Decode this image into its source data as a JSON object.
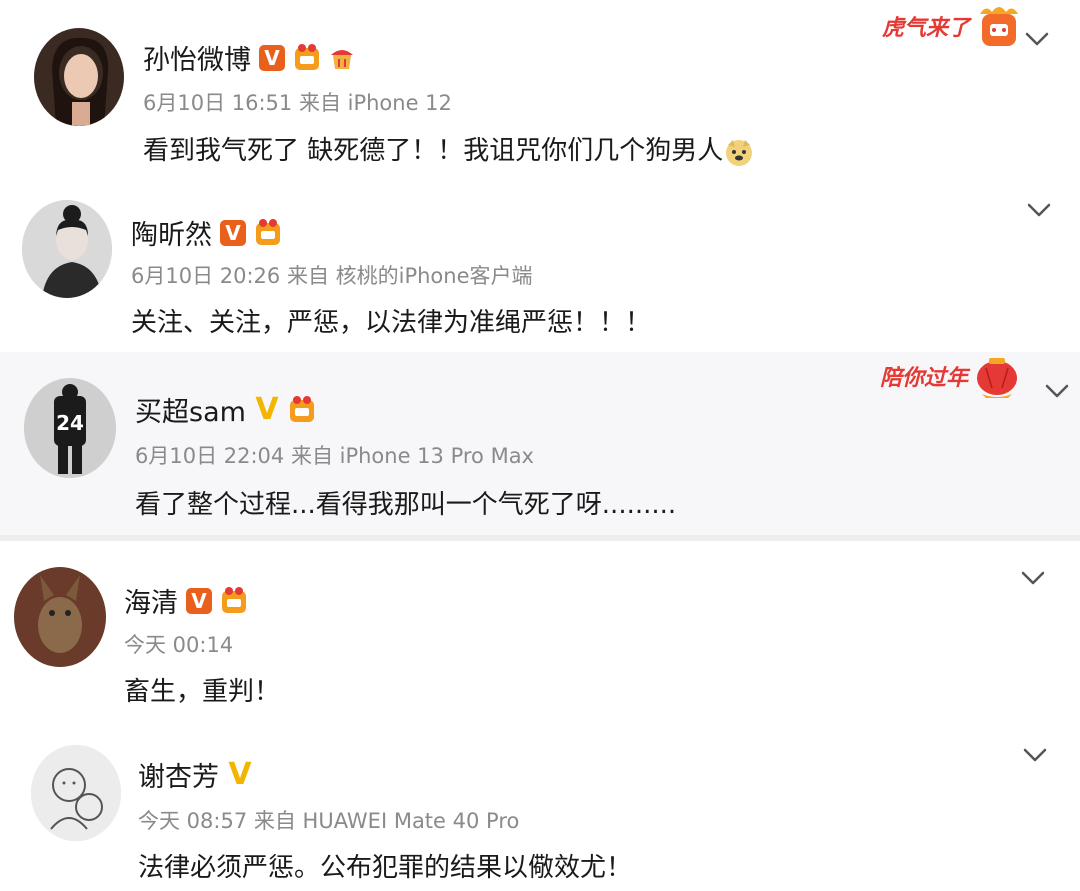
{
  "comments": [
    {
      "name": "孙怡微博",
      "meta": "6月10日 16:51 来自 iPhone 12",
      "text": "看到我气死了 缺死德了！！我诅咒你们几个狗男人",
      "deco_text": "虎气来了"
    },
    {
      "name": "陶昕然",
      "meta": "6月10日 20:26 来自 核桃的iPhone客户端",
      "text": "关注、关注，严惩，以法律为准绳严惩！！！"
    },
    {
      "name": "买超sam",
      "meta": "6月10日 22:04 来自 iPhone 13 Pro Max",
      "text": "看了整个过程...看得我那叫一个气死了呀.........",
      "deco_text": "陪你过年",
      "avatar_text": "24"
    },
    {
      "name": "海清",
      "meta": "今天 00:14",
      "text": "畜生，重判！"
    },
    {
      "name": "谢杏芳",
      "meta": "今天 08:57 来自 HUAWEI Mate 40 Pro",
      "text": "法律必须严惩。公布犯罪的结果以儆效尤！"
    }
  ],
  "icons": {
    "verified": "V",
    "expand": "chevron-down-icon",
    "fan_badge": "fan-badge-icon"
  },
  "colors": {
    "verified_orange": "#e8601c",
    "verified_yellow": "#f2b600",
    "deco_red": "#e53935",
    "meta_gray": "#8a8a8a"
  }
}
